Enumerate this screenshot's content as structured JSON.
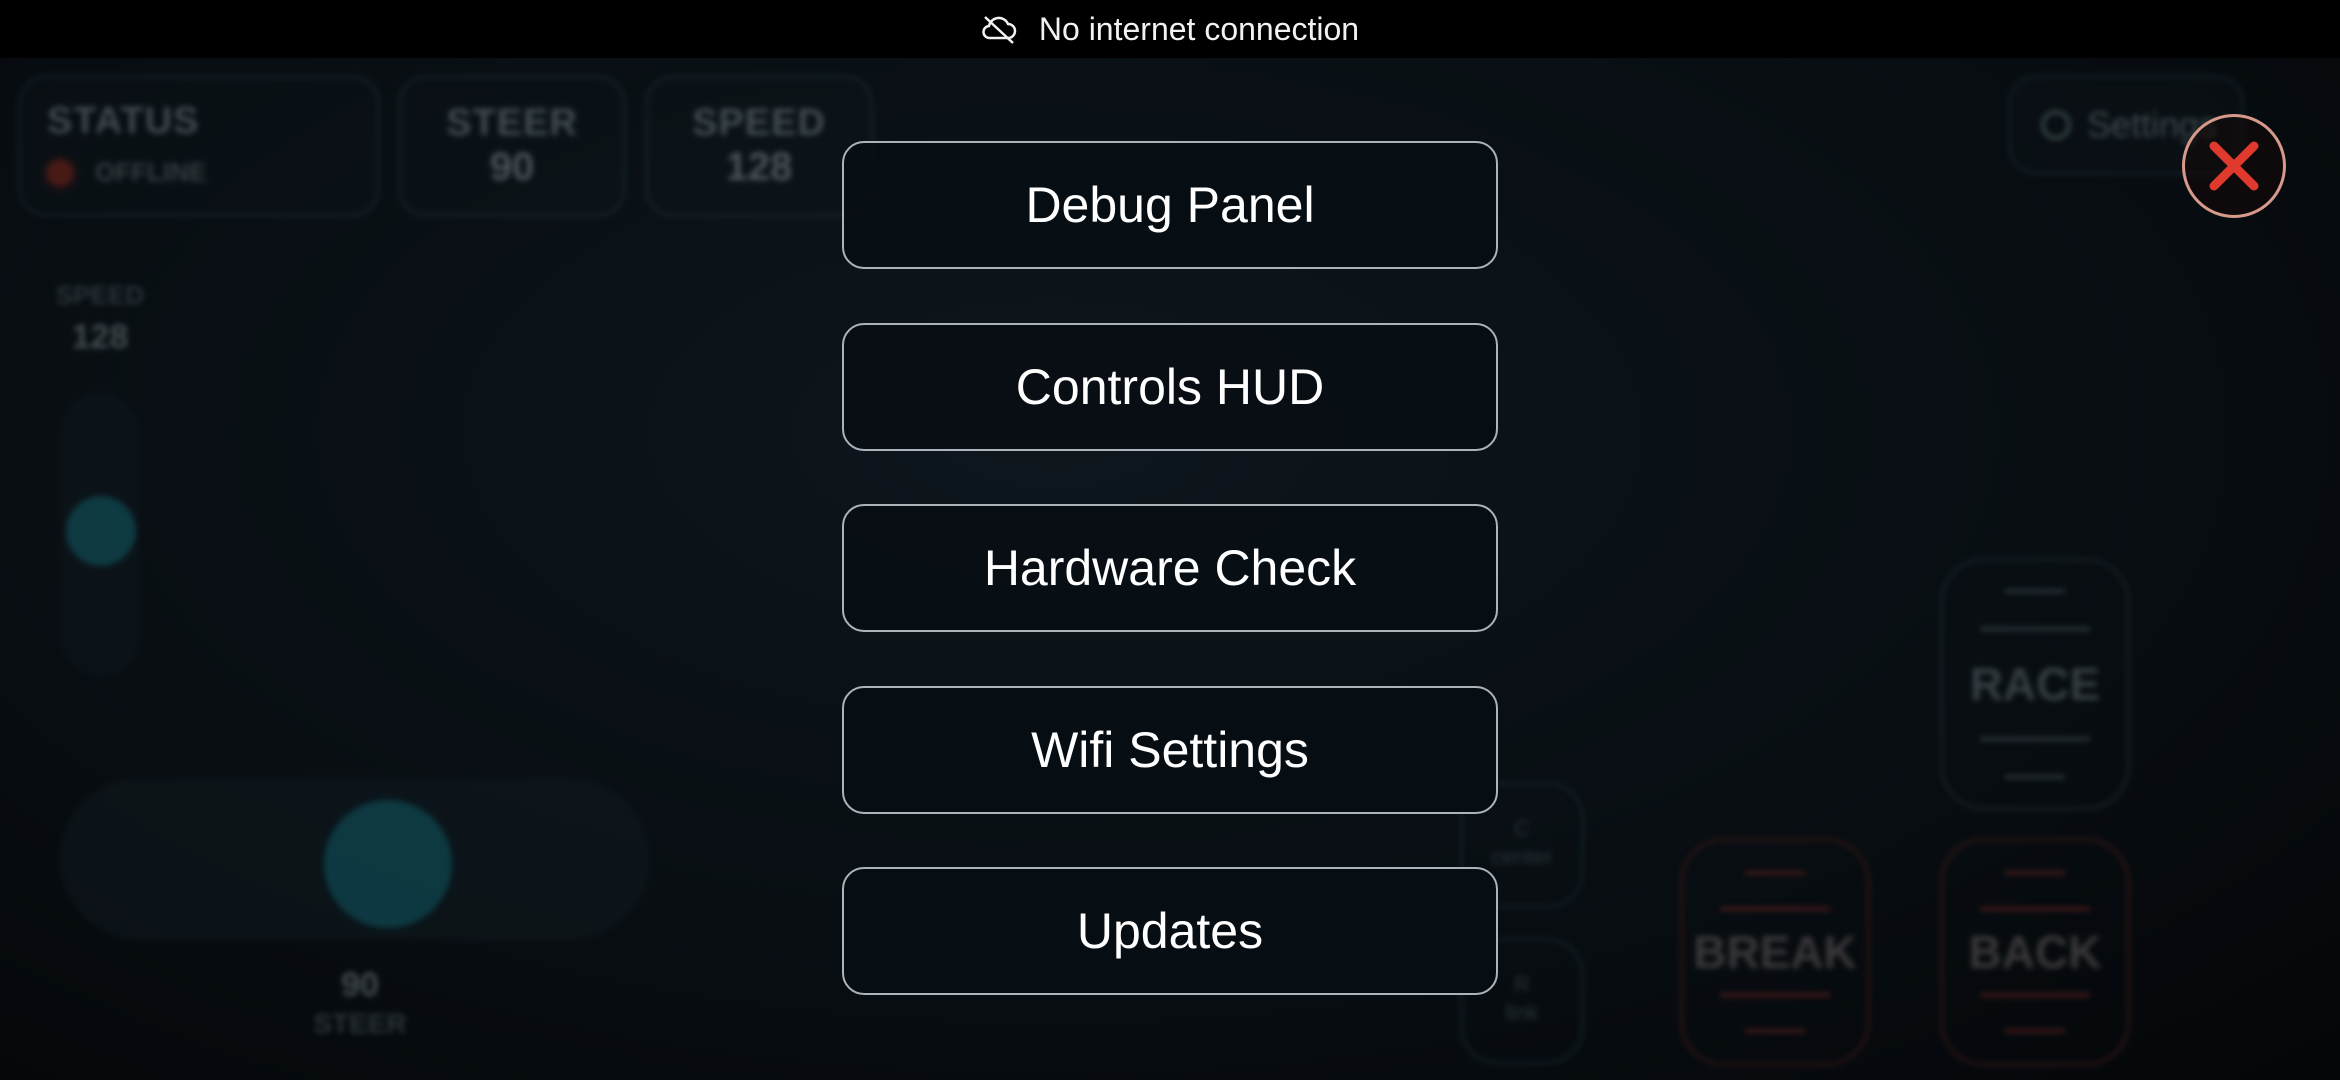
{
  "system": {
    "network_status": "No internet connection"
  },
  "background": {
    "status": {
      "title": "STATUS",
      "state": "OFFLINE"
    },
    "steer_card": {
      "title": "STEER",
      "value": "90"
    },
    "speed_card": {
      "title": "SPEED",
      "value": "128"
    },
    "settings_label": "Settings",
    "speed_slider": {
      "label": "SPEED",
      "value": "128"
    },
    "steer_slider": {
      "value": "90",
      "label": "STEER"
    },
    "center_button": {
      "key": "C",
      "label": "center"
    },
    "link_button": {
      "key": "R",
      "label": "link"
    },
    "race_label": "RACE",
    "break_label": "BREAK",
    "back_label": "BACK"
  },
  "menu": {
    "items": [
      {
        "label": "Debug Panel"
      },
      {
        "label": "Controls HUD"
      },
      {
        "label": "Hardware Check"
      },
      {
        "label": "Wifi Settings"
      },
      {
        "label": "Updates"
      }
    ],
    "close_icon": "close-x-icon"
  },
  "colors": {
    "accent_teal": "#1f8fa1",
    "offline_red": "#c0392b",
    "close_red": "#e03a2e"
  }
}
